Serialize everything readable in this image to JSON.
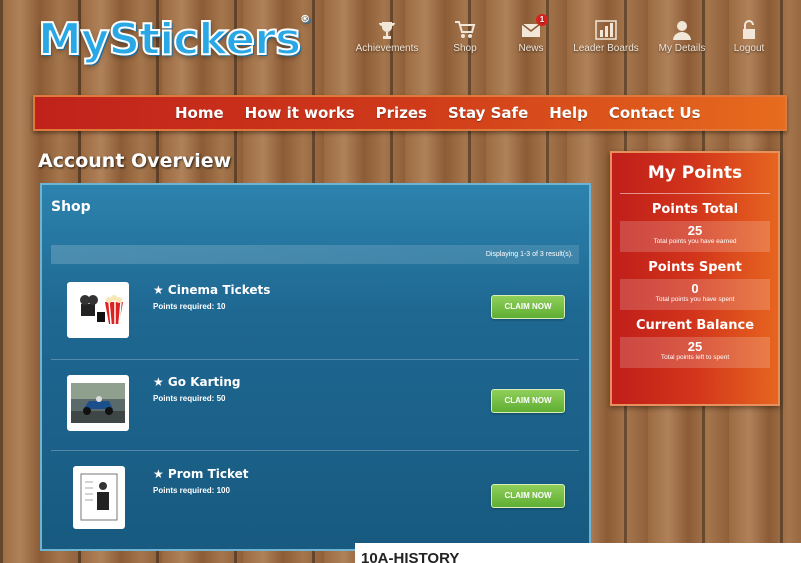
{
  "brand": {
    "logo_text": "MyStickers",
    "reg_mark": "®"
  },
  "topnav": [
    {
      "label": "Achievements",
      "icon": "trophy-icon"
    },
    {
      "label": "Shop",
      "icon": "cart-icon"
    },
    {
      "label": "News",
      "icon": "mail-icon",
      "badge": "1"
    },
    {
      "label": "Leader Boards",
      "icon": "bar-chart-icon"
    },
    {
      "label": "My Details",
      "icon": "user-icon"
    },
    {
      "label": "Logout",
      "icon": "padlock-icon"
    }
  ],
  "mainnav": [
    "Home",
    "How it works",
    "Prizes",
    "Stay Safe",
    "Help",
    "Contact Us"
  ],
  "page_title": "Account Overview",
  "shop": {
    "title": "Shop",
    "results": "Displaying 1-3 of 3 result(s).",
    "items": [
      {
        "name": "★ Cinema Tickets",
        "points": "Points required: 10",
        "button": "CLAIM NOW"
      },
      {
        "name": "★ Go Karting",
        "points": "Points required: 50",
        "button": "CLAIM NOW"
      },
      {
        "name": "★ Prom Ticket",
        "points": "Points required: 100",
        "button": "CLAIM NOW"
      }
    ]
  },
  "points": {
    "title": "My Points",
    "total": {
      "label": "Points Total",
      "value": "25",
      "sub": "Total points you have earned"
    },
    "spent": {
      "label": "Points Spent",
      "value": "0",
      "sub": "Total points you have spent"
    },
    "balance": {
      "label": "Current Balance",
      "value": "25",
      "sub": "Total points left to spent"
    }
  },
  "bottom_text": "10A-HISTORY",
  "colors": {
    "accent_red": "#c0221b",
    "accent_orange": "#e76c1e",
    "panel_blue": "#1e6892",
    "claim_green": "#5fae33"
  }
}
